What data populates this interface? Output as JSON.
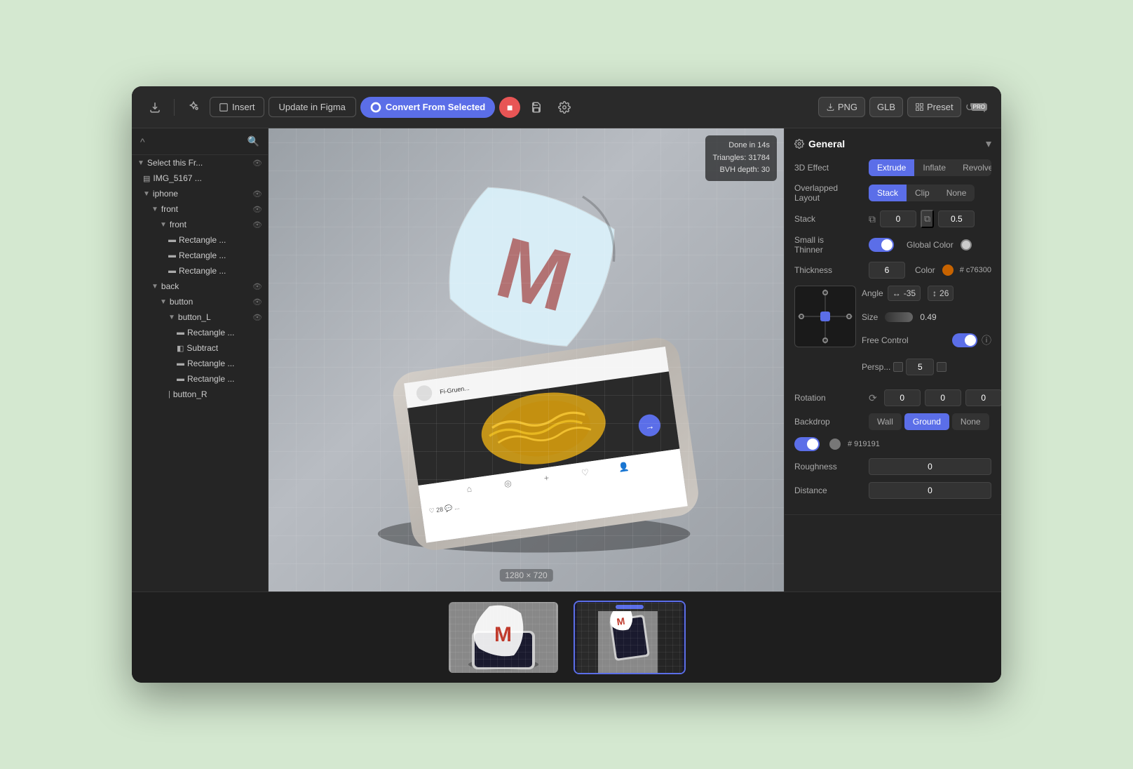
{
  "topBar": {
    "insert_label": "Insert",
    "update_label": "Update in Figma",
    "convert_label": "Convert From Selected",
    "png_label": "PNG",
    "glb_label": "GLB",
    "preset_label": "Preset",
    "pro_label": "PRO"
  },
  "sidebar": {
    "items": [
      {
        "label": "Select this Fr...",
        "indent": 0,
        "type": "frame",
        "has_arrow": true
      },
      {
        "label": "IMG_5167 ...",
        "indent": 1,
        "type": "image",
        "has_arrow": false
      },
      {
        "label": "iphone",
        "indent": 1,
        "type": "group",
        "has_arrow": true
      },
      {
        "label": "front",
        "indent": 2,
        "type": "group",
        "has_arrow": true
      },
      {
        "label": "front",
        "indent": 3,
        "type": "group",
        "has_arrow": true
      },
      {
        "label": "Rectangle ...",
        "indent": 4,
        "type": "rect"
      },
      {
        "label": "Rectangle ...",
        "indent": 4,
        "type": "rect"
      },
      {
        "label": "Rectangle ...",
        "indent": 4,
        "type": "rect"
      },
      {
        "label": "back",
        "indent": 2,
        "type": "group",
        "has_arrow": true
      },
      {
        "label": "button",
        "indent": 3,
        "type": "group",
        "has_arrow": true
      },
      {
        "label": "button_L",
        "indent": 4,
        "type": "group",
        "has_arrow": true
      },
      {
        "label": "Rectangle ...",
        "indent": 5,
        "type": "rect"
      },
      {
        "label": "Subtract",
        "indent": 5,
        "type": "path"
      },
      {
        "label": "Rectangle ...",
        "indent": 5,
        "type": "rect"
      },
      {
        "label": "Rectangle ...",
        "indent": 5,
        "type": "rect"
      },
      {
        "label": "button_R",
        "indent": 4,
        "type": "text"
      }
    ]
  },
  "viewport": {
    "info": {
      "done_label": "Done in 14s",
      "triangles_label": "Triangles: 31784",
      "bvh_label": "BVH depth: 30"
    },
    "size_label": "1280 × 720"
  },
  "rightPanel": {
    "title": "General",
    "effects": {
      "label": "3D Effect",
      "options": [
        "Extrude",
        "Inflate",
        "Revolve"
      ],
      "active": "Extrude"
    },
    "overlapped": {
      "label": "Overlapped Layout",
      "options": [
        "Stack",
        "Clip",
        "None"
      ],
      "active": "Stack"
    },
    "stack": {
      "label": "Stack",
      "value": "0",
      "value2": "0.5"
    },
    "small_is_thinner": {
      "label": "Small is Thinner",
      "enabled": true
    },
    "global_color": {
      "label": "Global Color"
    },
    "thickness": {
      "label": "Thickness",
      "value": "6"
    },
    "color": {
      "label": "Color",
      "hex": "# c76300",
      "dot_color": "#c76300"
    },
    "angle": {
      "label": "Angle",
      "h_value": "-35",
      "v_value": "26"
    },
    "size": {
      "label": "Size",
      "value": "0.49"
    },
    "free_control": {
      "label": "Free Control",
      "enabled": true
    },
    "perspective": {
      "label": "Persp...",
      "value": "5"
    },
    "rotation": {
      "label": "Rotation",
      "x": "0",
      "y": "0",
      "z": "0"
    },
    "backdrop": {
      "label": "Backdrop",
      "options": [
        "Wall",
        "Ground",
        "None"
      ],
      "active": "Ground",
      "color_hex": "# 919191",
      "roughness_label": "Roughness",
      "roughness_value": "0",
      "distance_label": "Distance",
      "distance_value": "0"
    }
  },
  "thumbnails": [
    {
      "id": 1,
      "active": false
    },
    {
      "id": 2,
      "active": true
    }
  ]
}
